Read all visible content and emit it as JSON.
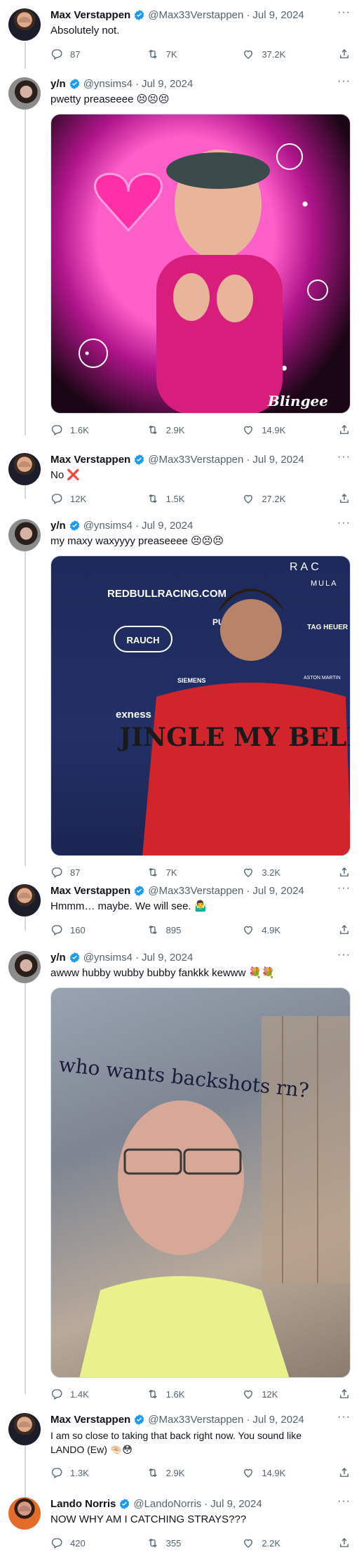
{
  "colors": {
    "verified": "#1d9bf0",
    "thread_line": "#cfd9de",
    "muted": "#536471",
    "text": "#0f1419"
  },
  "icons": {
    "reply": "speech-bubble",
    "retweet": "retweet-arrows",
    "like": "heart",
    "share": "share-arrow-up",
    "more": "horizontal-ellipsis",
    "verified": "verified-badge"
  },
  "tweets": [
    {
      "name": "Max Verstappen",
      "handle": "@Max33Verstappen",
      "date": "Jul 9, 2024",
      "text": "Absolutely not.",
      "replies": "87",
      "retweets": "7K",
      "likes": "37.2K"
    },
    {
      "name": "y/n",
      "handle": "@ynsims4",
      "date": "Jul 9, 2024",
      "text": "pwetty preaseeee 😣😣😣",
      "media_caption": "Blingee",
      "replies": "1.6K",
      "retweets": "2.9K",
      "likes": "14.9K"
    },
    {
      "name": "Max Verstappen",
      "handle": "@Max33Verstappen",
      "date": "Jul 9, 2024",
      "text": "No ❌",
      "replies": "12K",
      "retweets": "1.5K",
      "likes": "27.2K"
    },
    {
      "name": "y/n",
      "handle": "@ynsims4",
      "date": "Jul 9, 2024",
      "text": "my maxy waxyyyy preaseeee 😣😣😣",
      "media_text": {
        "banner": "REDBULLRACING.COM",
        "sponsor": "RAUCH",
        "sponsor2": "exness",
        "sponsor3": "SIEMENS",
        "sponsor4": "TAG HEUER",
        "sponsor5": "ASTON MARTIN",
        "sponsor6": "PUMA",
        "top_right": "RAC",
        "top_right2": "MULA",
        "sweater": "JINGLE MY BELLS"
      },
      "replies": "87",
      "retweets": "7K",
      "likes": "3.2K"
    },
    {
      "name": "Max Verstappen",
      "handle": "@Max33Verstappen",
      "date": "Jul 9, 2024",
      "text": "Hmmm… maybe. We will see. 🤷‍♂️",
      "replies": "160",
      "retweets": "895",
      "likes": "4.9K"
    },
    {
      "name": "y/n",
      "handle": "@ynsims4",
      "date": "Jul 9, 2024",
      "text": "awww hubby wubby bubby fankkk kewww 💐💐",
      "media_caption": "who wants backshots rn?",
      "replies": "1.4K",
      "retweets": "1.6K",
      "likes": "12K"
    },
    {
      "name": "Max Verstappen",
      "handle": "@Max33Verstappen",
      "date": "Jul 9, 2024",
      "text_line1": "I am so close to taking that back right now. You sound like",
      "text_line2": "LANDO (Ew) 🤏🏻😳",
      "replies": "1.3K",
      "retweets": "2.9K",
      "likes": "14.9K"
    },
    {
      "name": "Lando Norris",
      "handle": "@LandoNorris",
      "date": "Jul 9, 2024",
      "text": "NOW WHY AM I CATCHING STRAYS???",
      "replies": "420",
      "retweets": "355",
      "likes": "2.2K"
    }
  ]
}
